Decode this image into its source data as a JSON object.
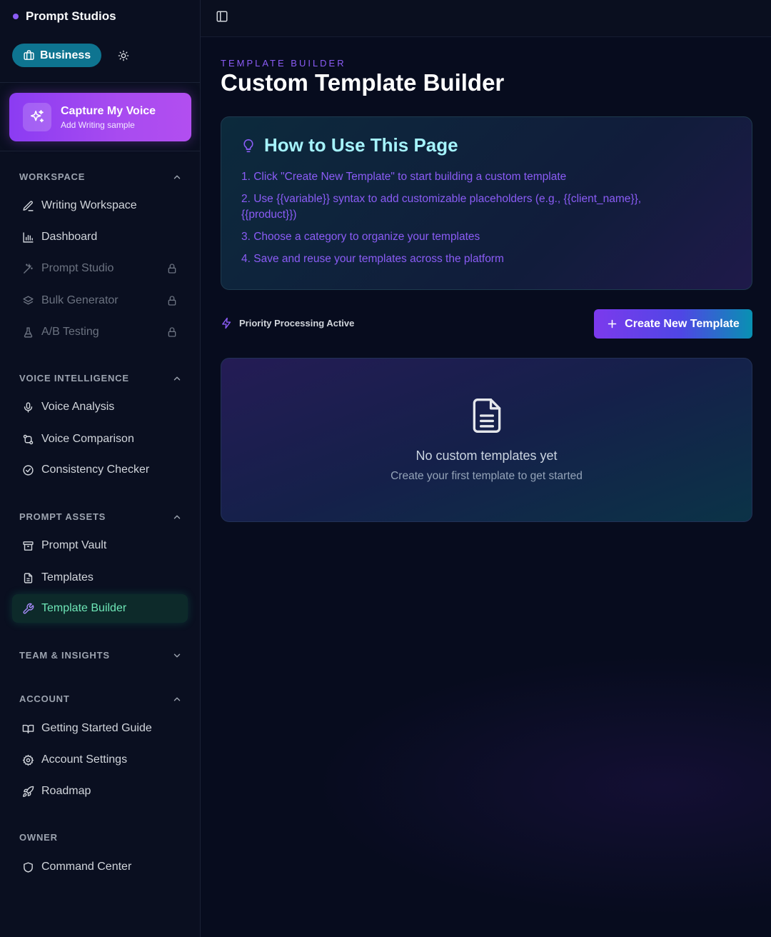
{
  "app": {
    "name": "Prompt Studios"
  },
  "plan": {
    "label": "Business"
  },
  "capture": {
    "title": "Capture My Voice",
    "subtitle": "Add Writing sample"
  },
  "sections": {
    "workspace": {
      "title": "WORKSPACE",
      "items": [
        "Writing Workspace",
        "Dashboard",
        "Prompt Studio",
        "Bulk Generator",
        "A/B Testing"
      ]
    },
    "voice": {
      "title": "VOICE INTELLIGENCE",
      "items": [
        "Voice Analysis",
        "Voice Comparison",
        "Consistency Checker"
      ]
    },
    "assets": {
      "title": "PROMPT ASSETS",
      "items": [
        "Prompt Vault",
        "Templates",
        "Template Builder"
      ]
    },
    "team": {
      "title": "TEAM & INSIGHTS"
    },
    "account": {
      "title": "ACCOUNT",
      "items": [
        "Getting Started Guide",
        "Account Settings",
        "Roadmap"
      ]
    },
    "owner": {
      "title": "OWNER",
      "items": [
        "Command Center"
      ]
    }
  },
  "page": {
    "kicker": "TEMPLATE BUILDER",
    "title": "Custom Template Builder"
  },
  "howto": {
    "title": "How to Use This Page",
    "steps": [
      "1. Click \"Create New Template\" to start building a custom template",
      "2. Use {{variable}} syntax to add customizable placeholders (e.g., {{client_name}}, {{product}})",
      "3. Choose a category to organize your templates",
      "4. Save and reuse your templates across the platform"
    ]
  },
  "status": {
    "label": "Priority Processing Active"
  },
  "actions": {
    "create_label": "Create New Template"
  },
  "empty": {
    "title": "No custom templates yet",
    "subtitle": "Create your first template to get started"
  },
  "colors": {
    "accent_purple": "#8b5cf6",
    "accent_cyan": "#0e7490",
    "active_green": "#6ee7b7",
    "background": "#070c1e"
  }
}
